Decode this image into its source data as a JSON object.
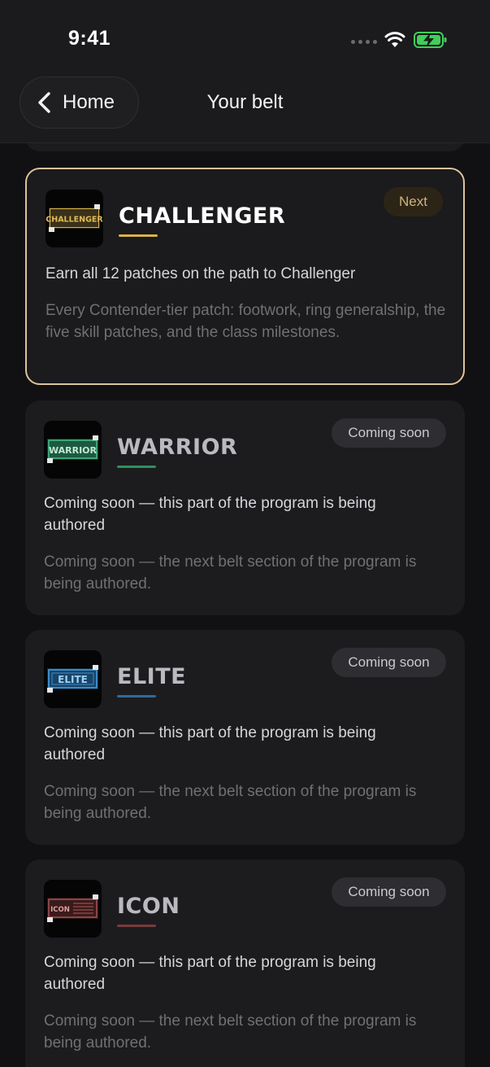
{
  "status_bar": {
    "time": "9:41"
  },
  "nav": {
    "back_label": "Home",
    "title": "Your belt"
  },
  "belts": [
    {
      "name": "CHALLENGER",
      "badge_text": "CHALLENGER",
      "accent": "#d8b24a",
      "pill": "Next",
      "subtitle": "Earn all 12 patches on the path to Challenger",
      "description": "Every Contender-tier patch: footwork, ring generalship, the five skill patches, and the class milestones."
    },
    {
      "name": "WARRIOR",
      "badge_text": "WARRIOR",
      "accent": "#2f8f5c",
      "pill": "Coming soon",
      "subtitle": "Coming soon — this part of the program is being authored",
      "description": "Coming soon — the next belt section of the program is being authored."
    },
    {
      "name": "ELITE",
      "badge_text": "ELITE",
      "accent": "#2f6a9a",
      "pill": "Coming soon",
      "subtitle": "Coming soon — this part of the program is being authored",
      "description": "Coming soon — the next belt section of the program is being authored."
    },
    {
      "name": "ICON",
      "badge_text": "ICON",
      "accent": "#7a3b3b",
      "pill": "Coming soon",
      "subtitle": "Coming soon — this part of the program is being authored",
      "description": "Coming soon — the next belt section of the program is being authored."
    }
  ]
}
